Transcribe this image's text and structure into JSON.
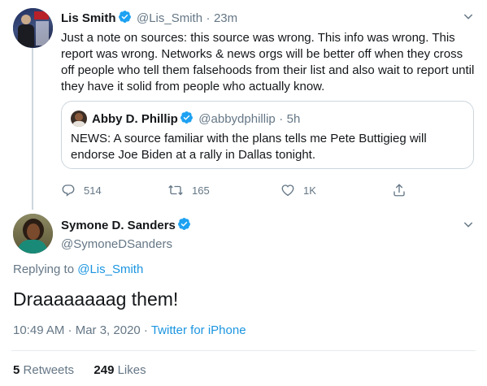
{
  "tweet1": {
    "name": "Lis Smith",
    "handle": "@Lis_Smith",
    "separator": "·",
    "time": "23m",
    "text": "Just a note on sources: this source was wrong. This info was wrong. This report was wrong.  Networks & news orgs will be better off when they cross off people who tell them falsehoods from their list and also wait to report until they have it solid from people who actually know.",
    "quote": {
      "name": "Abby D. Phillip",
      "handle": "@abbydphillip",
      "separator": "·",
      "time": "5h",
      "text": "NEWS: A source familiar with the plans tells me Pete Buttigieg will endorse Joe Biden at a rally in Dallas tonight."
    },
    "replies": "514",
    "retweets": "165",
    "likes": "1K"
  },
  "tweet2": {
    "name": "Symone D. Sanders",
    "handle": "@SymoneDSanders",
    "replying_prefix": "Replying to ",
    "replying_handle": "@Lis_Smith",
    "text": "Draaaaaaaag them!",
    "timestamp": "10:49 AM · Mar 3, 2020 · ",
    "source": "Twitter for iPhone",
    "retweet_count": "5",
    "retweet_label": "Retweets",
    "like_count": "249",
    "like_label": "Likes"
  },
  "colors": {
    "accent": "#1b95e0",
    "verified": "#1da1f2",
    "secondary_text": "#657786",
    "border": "#ccd6dd"
  },
  "icons": [
    "verified-badge-icon",
    "chevron-down-icon",
    "reply-icon",
    "retweet-icon",
    "like-icon",
    "share-icon"
  ]
}
